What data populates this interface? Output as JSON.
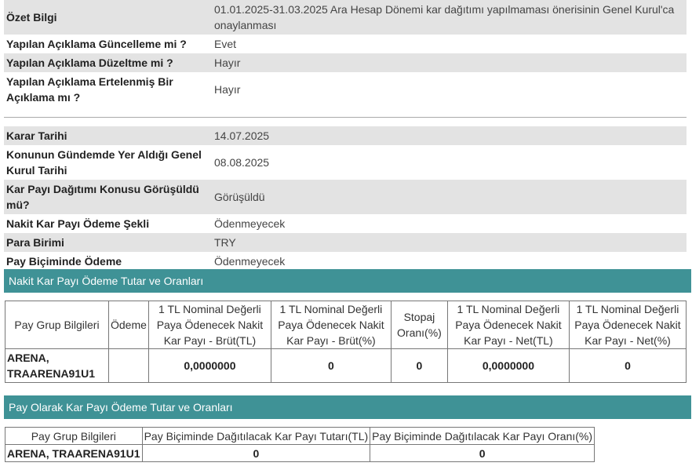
{
  "info1": [
    {
      "label": "Özet Bilgi",
      "value": "01.01.2025-31.03.2025 Ara Hesap Dönemi kar dağıtımı yapılmaması önerisinin Genel Kurul'ca onaylanması"
    },
    {
      "label": "Yapılan Açıklama Güncelleme mi ?",
      "value": "Evet"
    },
    {
      "label": "Yapılan Açıklama Düzeltme mi ?",
      "value": "Hayır"
    },
    {
      "label": "Yapılan Açıklama Ertelenmiş Bir Açıklama mı ?",
      "value": "Hayır"
    }
  ],
  "info2": [
    {
      "label": "Karar Tarihi",
      "value": "14.07.2025"
    },
    {
      "label": "Konunun Gündemde Yer Aldığı Genel Kurul Tarihi",
      "value": "08.08.2025"
    },
    {
      "label": "Kar Payı Dağıtımı Konusu Görüşüldü mü?",
      "value": "Görüşüldü"
    },
    {
      "label": "Nakit Kar Payı Ödeme Şekli",
      "value": "Ödenmeyecek"
    },
    {
      "label": "Para Birimi",
      "value": "TRY"
    },
    {
      "label": "Pay Biçiminde Ödeme",
      "value": "Ödenmeyecek"
    }
  ],
  "section1": {
    "title": "Nakit Kar Payı Ödeme Tutar ve Oranları",
    "headers": [
      "Pay Grup Bilgileri",
      "Ödeme",
      "1 TL Nominal Değerli Paya Ödenecek Nakit Kar Payı - Brüt(TL)",
      "1 TL Nominal Değerli Paya Ödenecek Nakit Kar Payı - Brüt(%)",
      "Stopaj Oranı(%)",
      "1 TL Nominal Değerli Paya Ödenecek Nakit Kar Payı - Net(TL)",
      "1 TL Nominal Değerli Paya Ödenecek Nakit Kar Payı - Net(%)"
    ],
    "row": [
      "ARENA, TRAARENA91U1",
      "",
      "0,0000000",
      "0",
      "0",
      "0,0000000",
      "0"
    ]
  },
  "section2": {
    "title": "Pay Olarak Kar Payı Ödeme Tutar ve Oranları",
    "headers": [
      "Pay Grup Bilgileri",
      "Pay Biçiminde Dağıtılacak Kar Payı Tutarı(TL)",
      "Pay Biçiminde Dağıtılacak Kar Payı Oranı(%)"
    ],
    "row": [
      "ARENA, TRAARENA91U1",
      "0",
      "0"
    ]
  }
}
